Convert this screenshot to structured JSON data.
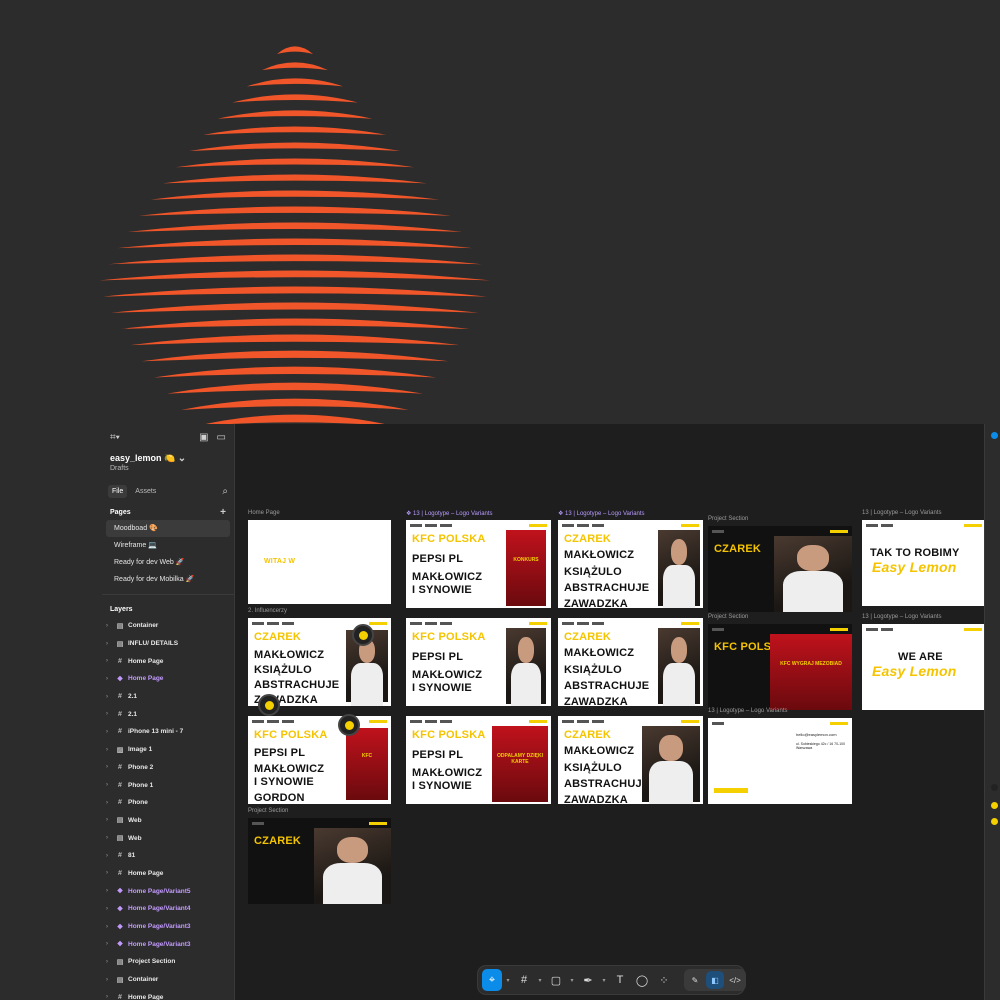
{
  "colors": {
    "logo_orange": "#f0562a",
    "yellow": "#f5d000",
    "purple": "#c39bff",
    "accent_blue": "#0c8ce9"
  },
  "file": {
    "name": "easy_lemon 🍋",
    "location": "Drafts"
  },
  "tabs": {
    "file": "File",
    "assets": "Assets"
  },
  "pages": {
    "heading": "Pages",
    "items": [
      "Moodboad 🎨",
      "Wireframe 💻",
      "Ready for dev Web 🚀",
      "Ready for dev Mobilka 🚀"
    ]
  },
  "layers": {
    "heading": "Layers",
    "items": [
      {
        "label": "Container",
        "icon": "section-icon",
        "kind": "normal"
      },
      {
        "label": "INFLU/ DETAILS",
        "icon": "section-icon",
        "kind": "normal"
      },
      {
        "label": "Home Page",
        "icon": "frame-icon",
        "kind": "normal"
      },
      {
        "label": "Home Page",
        "icon": "component-icon",
        "kind": "component"
      },
      {
        "label": "2.1",
        "icon": "frame-icon",
        "kind": "normal"
      },
      {
        "label": "2.1",
        "icon": "frame-icon",
        "kind": "normal"
      },
      {
        "label": "iPhone 13 mini - 7",
        "icon": "frame-icon",
        "kind": "normal"
      },
      {
        "label": "Image 1",
        "icon": "image-icon",
        "kind": "normal"
      },
      {
        "label": "Phone 2",
        "icon": "frame-icon",
        "kind": "normal"
      },
      {
        "label": "Phone 1",
        "icon": "frame-icon",
        "kind": "normal"
      },
      {
        "label": "Phone",
        "icon": "frame-icon",
        "kind": "normal"
      },
      {
        "label": "Web",
        "icon": "section-icon",
        "kind": "normal"
      },
      {
        "label": "Web",
        "icon": "section-icon",
        "kind": "normal"
      },
      {
        "label": "81",
        "icon": "frame-icon",
        "kind": "normal"
      },
      {
        "label": "Home Page",
        "icon": "frame-icon",
        "kind": "normal"
      },
      {
        "label": "Home Page/Variant5",
        "icon": "component-icon",
        "kind": "component"
      },
      {
        "label": "Home Page/Variant4",
        "icon": "component-icon",
        "kind": "component"
      },
      {
        "label": "Home Page/Variant3",
        "icon": "component-icon",
        "kind": "component"
      },
      {
        "label": "Home Page/Variant3",
        "icon": "component-icon",
        "kind": "component"
      },
      {
        "label": "Project Section",
        "icon": "section-icon",
        "kind": "normal"
      },
      {
        "label": "Container",
        "icon": "section-icon",
        "kind": "normal"
      },
      {
        "label": "Home Page",
        "icon": "frame-icon",
        "kind": "normal"
      }
    ]
  },
  "canvas": {
    "labels": {
      "home_page": "Home Page",
      "influencerzy": "2. Influencerzy",
      "logotype_1": "❖ 13 | Logotype – Logo Variants",
      "logotype_2": "❖ 13 | Logotype – Logo Variants",
      "project_section_1": "Project Section",
      "project_section_2": "Project Section",
      "project_section_3": "Project Section",
      "logotype_3": "13 | Logotype – Logo Variants",
      "logotype_4": "13 | Logotype – Logo Variants",
      "logotype_5": "13 | Logotype – Logo Variants"
    },
    "frame_text": {
      "witaj": "WITAJ W",
      "kfc": "KFC POLSKA",
      "pepsi": "PEPSI PL",
      "maklowicz_synowie_1": "MAKŁOWICZ",
      "maklowicz_synowie_2": "I SYNOWIE",
      "czarek": "CZAREK",
      "maklowicz": "MAKŁOWICZ",
      "ksiazulo": "KSIĄŻULO",
      "abstrachuje": "ABSTRACHUJE",
      "zawadzka": "ZAWADZKA",
      "gordon": "GORDON",
      "tak_to_robimy": "TAK TO ROBIMY",
      "easy_lemon": "Easy Lemon",
      "we_are": "WE ARE",
      "odpalamy": "ODPALAMY DZIĘKI KARTE",
      "kfc_wygraj": "KFC WYGRAJ MEZOBIAD",
      "contact_email": "hello@easylemon.com",
      "contact_addr": "ul. Sobieskiego 42c / 16 70-100 Warszawa"
    }
  },
  "toolbar": {
    "tools": [
      "move-tool",
      "frame-tool",
      "shape-tool",
      "pen-tool",
      "text-tool",
      "comment-tool",
      "actions-tool"
    ],
    "glyphs": {
      "move": "⌖",
      "frame": "#",
      "shape": "▢",
      "pen": "✒",
      "text": "T",
      "comment": "◯",
      "actions": "⁘",
      "draw": "✎",
      "design": "◧",
      "dev": "</>"
    }
  }
}
